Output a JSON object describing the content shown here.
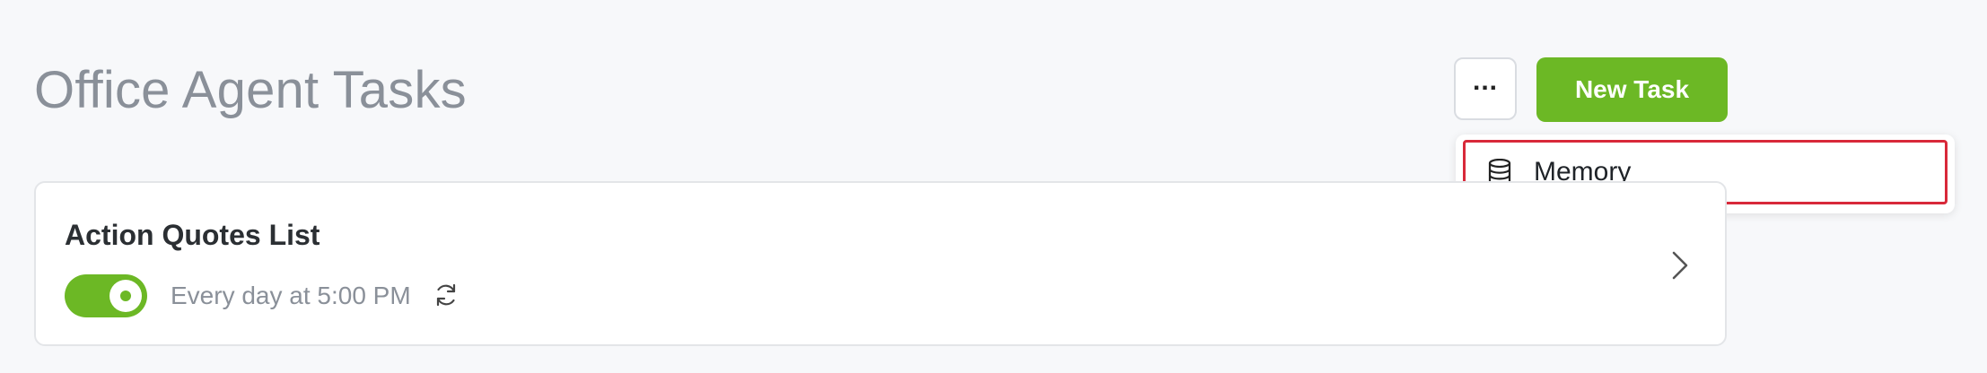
{
  "header": {
    "title": "Office Agent Tasks",
    "more_label": "...",
    "new_task_label": "New Task"
  },
  "dropdown": {
    "items": [
      {
        "label": "Memory",
        "icon": "database-icon"
      }
    ]
  },
  "tasks": [
    {
      "title": "Action Quotes List",
      "enabled": true,
      "schedule": "Every day at 5:00 PM",
      "icon": "repeat-icon"
    }
  ],
  "colors": {
    "accent": "#6cb825",
    "highlight_border": "#d8293a",
    "muted_text": "#8a9099"
  }
}
